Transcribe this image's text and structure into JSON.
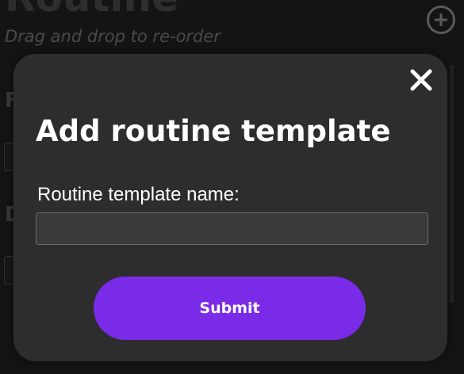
{
  "background": {
    "title": "Routine",
    "subtitle": "Drag and drop to re-order",
    "add_icon": "plus-circle-icon",
    "section_letter_1": "F",
    "section_letter_2": "D"
  },
  "modal": {
    "close_icon": "close-icon",
    "title": "Add routine template",
    "field_label": "Routine template name:",
    "input_value": "",
    "submit_label": "Submit"
  },
  "colors": {
    "page_bg": "#141414",
    "modal_bg": "#2d2d2d",
    "accent": "#7a2be8",
    "text": "#ffffff"
  }
}
